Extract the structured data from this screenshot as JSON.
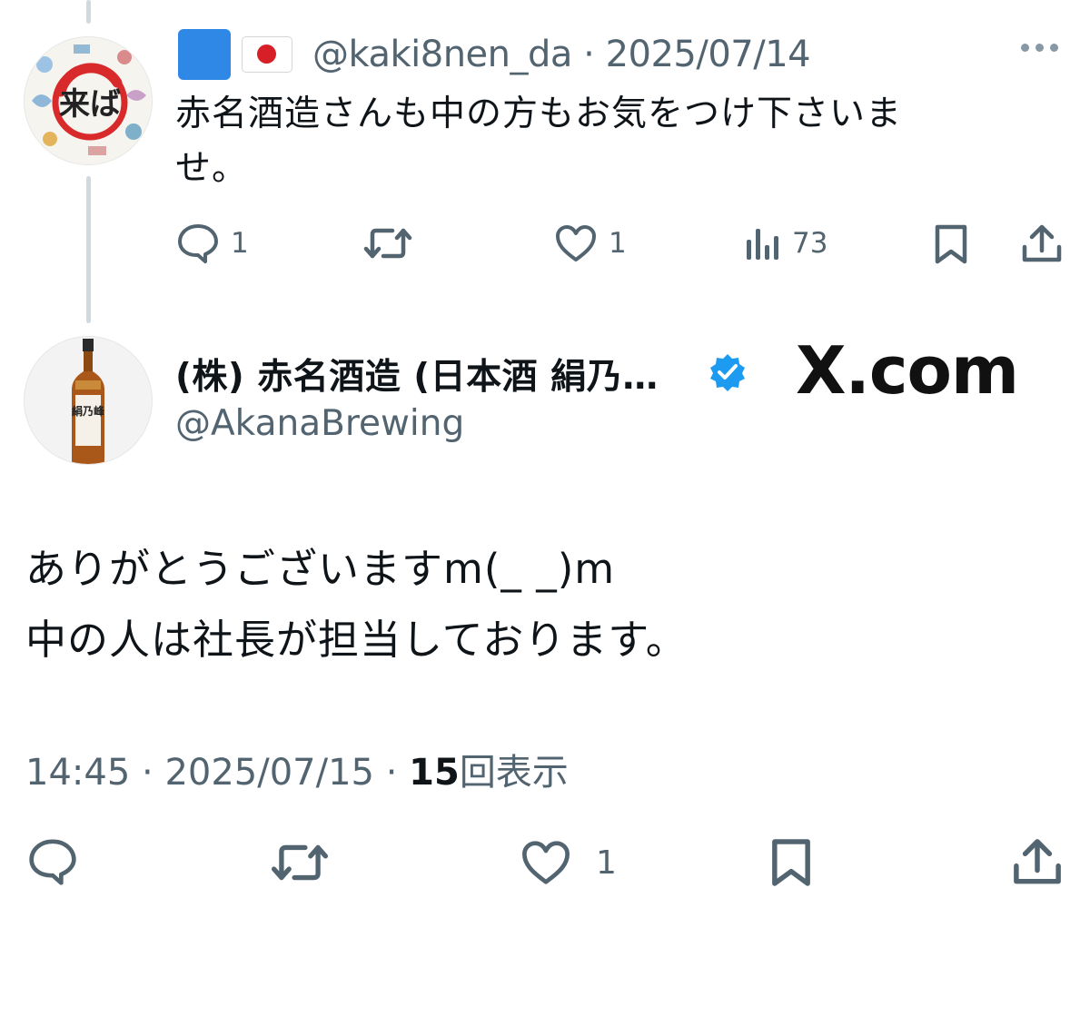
{
  "reply": {
    "handle": "@kaki8nen_da",
    "date": "2025/07/14",
    "text_line1": "赤名酒造さんも中の方もお気をつけ下さいま",
    "text_line2": "せ。",
    "flags": [
      "blue-square",
      "japan-flag"
    ],
    "actions": {
      "reply_count": "1",
      "repost_count": "",
      "like_count": "1",
      "views_count": "73"
    },
    "avatar_logo_text": "来ば"
  },
  "main": {
    "display_name": "(株) 赤名酒造 (日本酒 絹乃…",
    "handle": "@AkanaBrewing",
    "text_line1": "ありがとうございますm(_ _)m",
    "text_line2": "中の人は社長が担当しております。",
    "time": "14:45",
    "date": "2025/07/15",
    "views_count": "15",
    "views_label": "回表示",
    "actions": {
      "like_count": "1"
    },
    "avatar_label_text": "絹乃峰"
  },
  "watermark": "X.com",
  "colors": {
    "text": "#0f1419",
    "secondary": "#536471",
    "verified": "#1d9bf0",
    "thread_line": "#cfd9de"
  }
}
